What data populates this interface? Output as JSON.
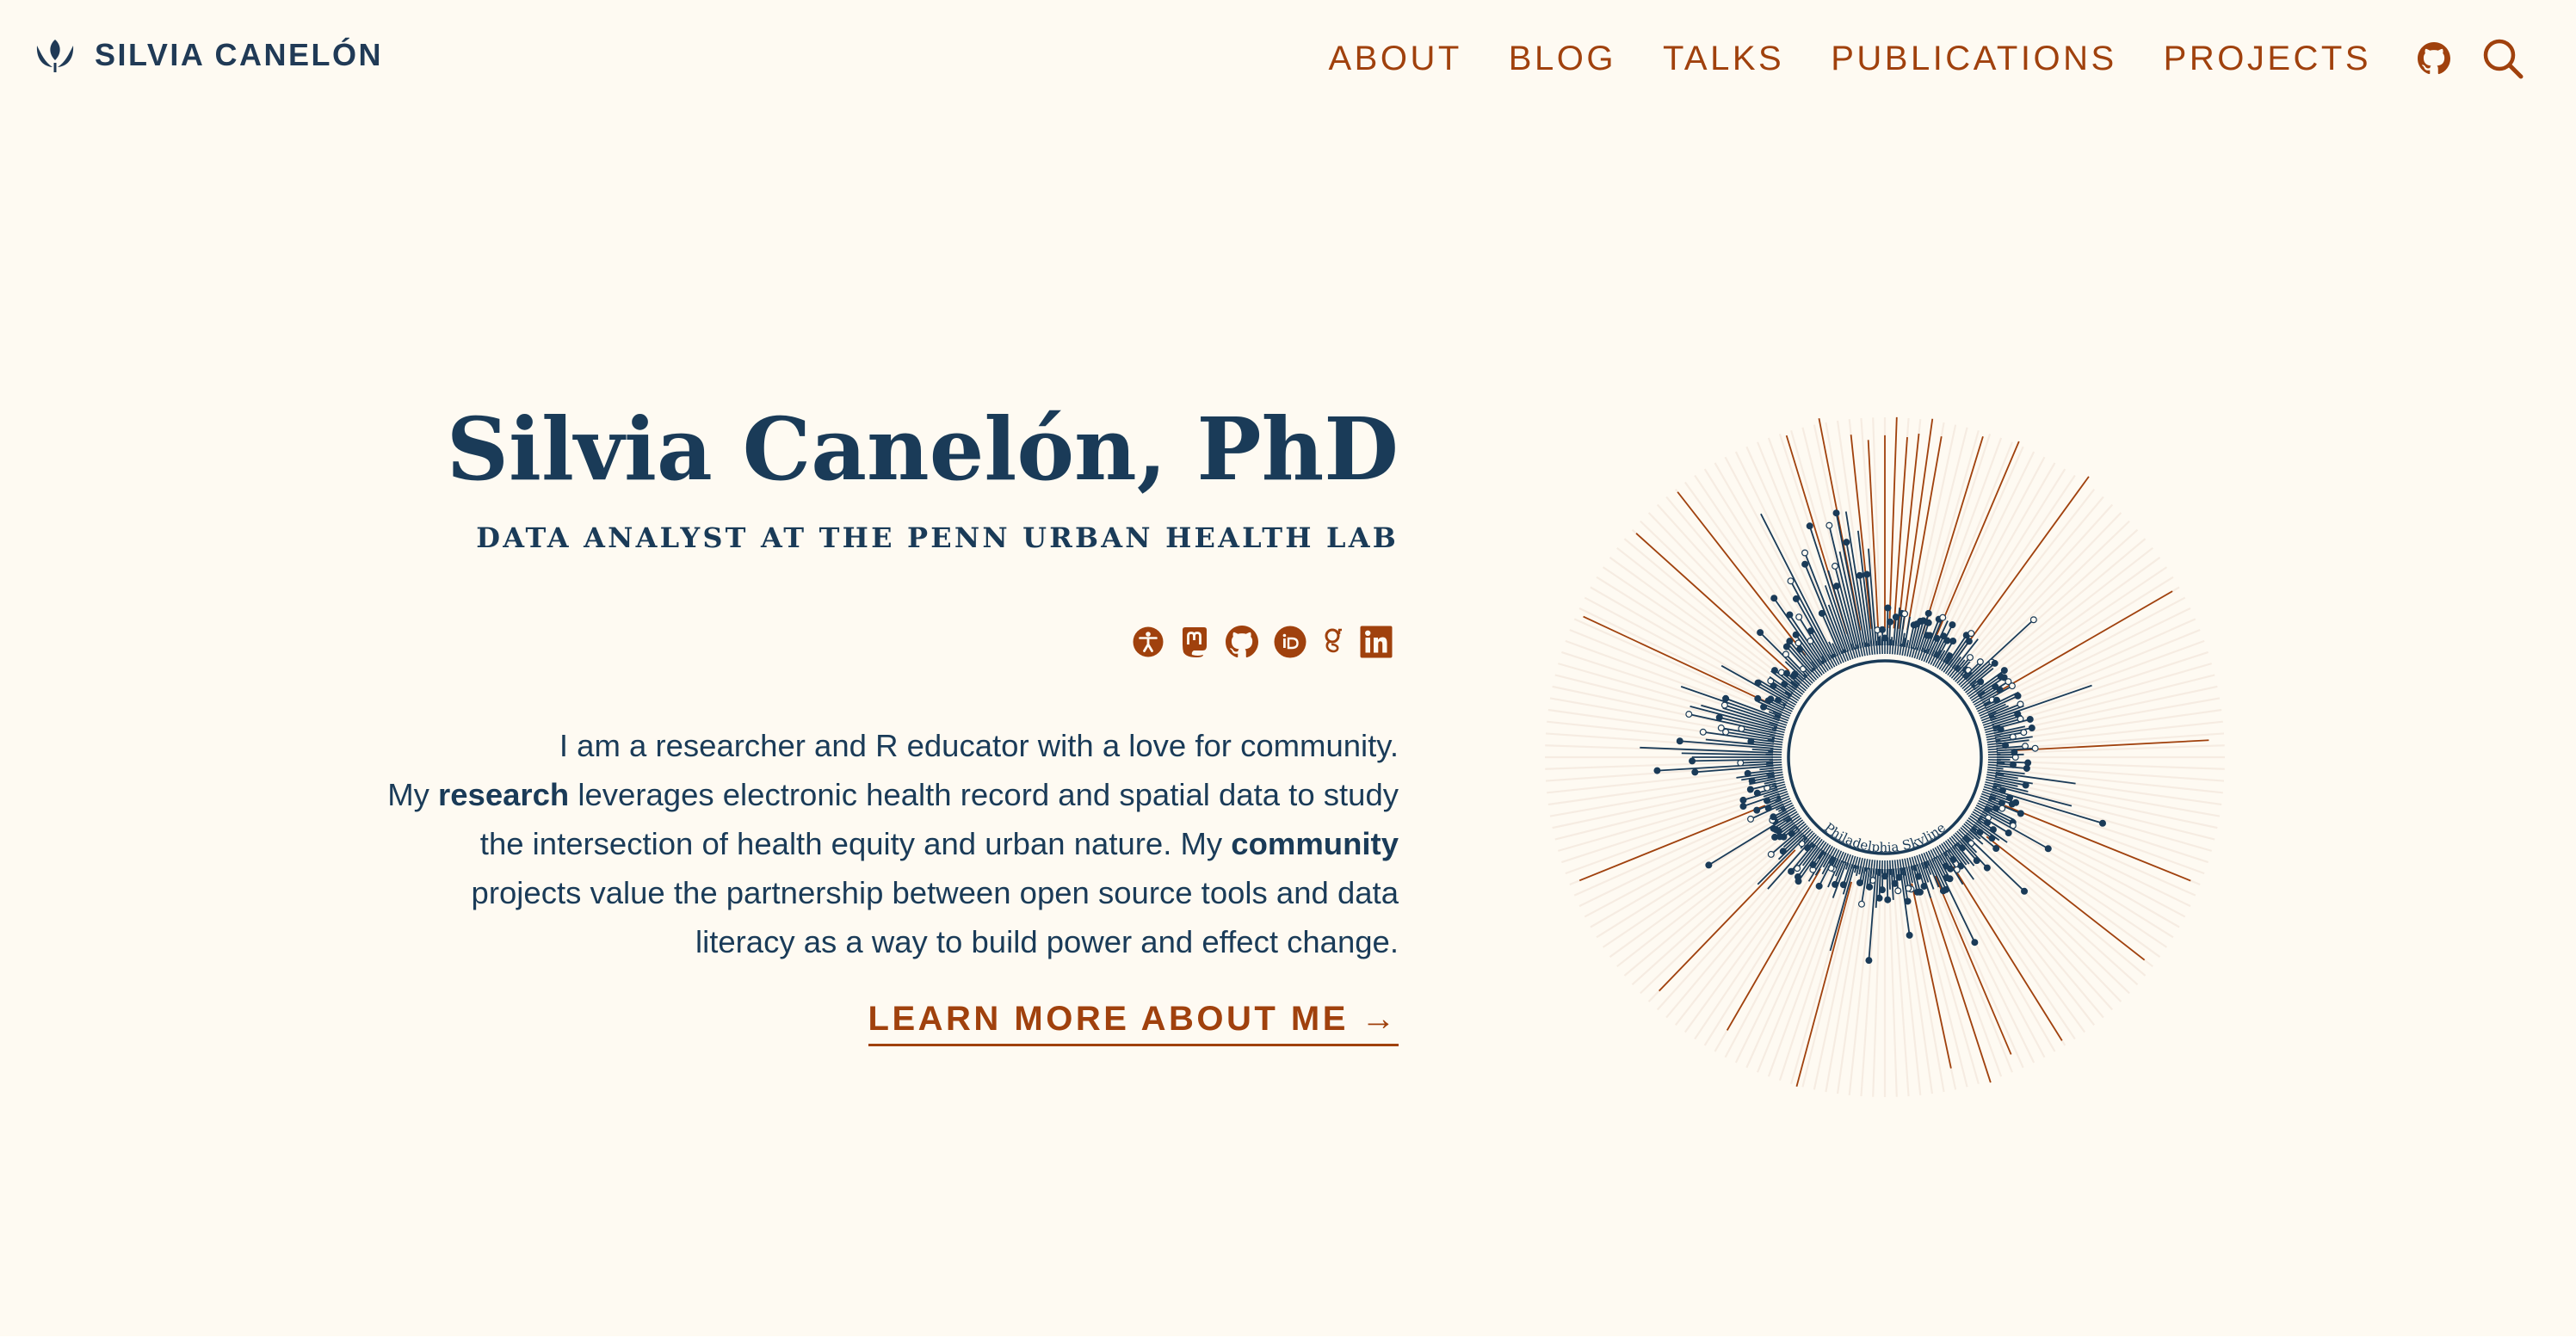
{
  "site": {
    "logo_text": "SILVIA CANELÓN",
    "logo_icon": "tulip-icon"
  },
  "nav": {
    "links": [
      "ABOUT",
      "BLOG",
      "TALKS",
      "PUBLICATIONS",
      "PROJECTS"
    ],
    "github_icon": "github-icon",
    "search_icon": "search-icon"
  },
  "hero": {
    "title": "Silvia Canelón, PhD",
    "subtitle": "DATA ANALYST AT THE PENN URBAN HEALTH LAB",
    "bio": {
      "line1": "I am a researcher and R educator with a love for community.",
      "line2_pre": "My ",
      "line2_bold": "research",
      "line2_post": " leverages electronic health record and spatial data to study",
      "line3_pre": "the intersection of health equity and urban nature. My ",
      "line3_bold": "community",
      "line4": "projects value the partnership between open source tools and data",
      "line5": "literacy as a way to build power and effect change."
    },
    "cta": "LEARN MORE ABOUT ME →"
  },
  "social": [
    {
      "name": "accessibility-icon"
    },
    {
      "name": "mastodon-icon"
    },
    {
      "name": "github-icon"
    },
    {
      "name": "orcid-icon"
    },
    {
      "name": "google-scholar-icon"
    },
    {
      "name": "linkedin-icon"
    }
  ],
  "viz": {
    "label": "Philadelphia Skyline"
  },
  "colors": {
    "background": "#fefaf2",
    "navy": "#1a3b58",
    "accent": "#a0410d",
    "spoke_light": "#f0e2d6"
  }
}
